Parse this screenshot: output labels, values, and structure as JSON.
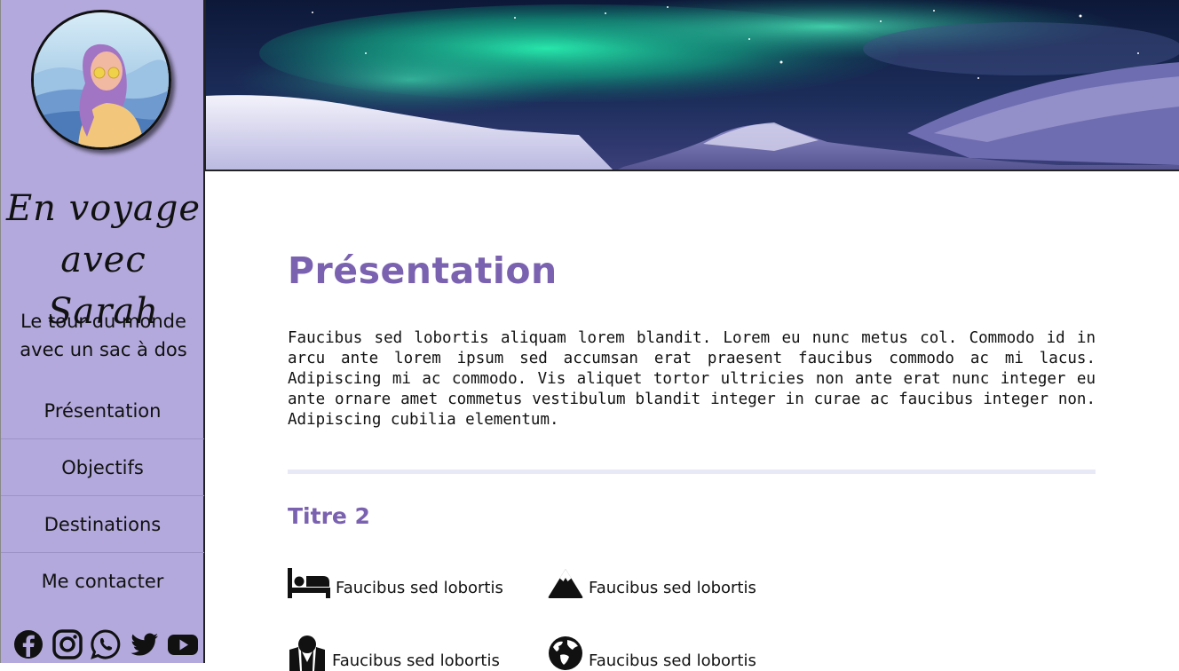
{
  "sidebar": {
    "brand_line1": "En voyage",
    "brand_line2": "avec Sarah",
    "tagline_line1": "Le tour du monde",
    "tagline_line2": "avec un sac à dos",
    "nav": [
      {
        "label": "Présentation"
      },
      {
        "label": "Objectifs"
      },
      {
        "label": "Destinations"
      },
      {
        "label": "Me contacter"
      }
    ],
    "social": [
      "facebook-icon",
      "instagram-icon",
      "whatsapp-icon",
      "twitter-icon",
      "youtube-icon"
    ]
  },
  "main": {
    "title": "Présentation",
    "paragraph": "Faucibus sed lobortis aliquam lorem blandit. Lorem eu nunc metus col. Commodo id in arcu ante lorem ipsum sed accumsan erat praesent faucibus commodo ac mi lacus. Adipiscing mi ac commodo. Vis aliquet tortor ultricies non ante erat nunc integer eu ante ornare amet commetus vestibulum blandit integer in curae ac faucibus integer non. Adipiscing cubilia elementum.",
    "subtitle": "Titre 2",
    "features": [
      {
        "icon": "bed-icon",
        "label": "Faucibus sed lobortis"
      },
      {
        "icon": "mountain-icon",
        "label": "Faucibus sed lobortis"
      },
      {
        "icon": "map-icon",
        "label": "Faucibus sed lobortis"
      },
      {
        "icon": "globe-icon",
        "label": "Faucibus sed lobortis"
      }
    ]
  },
  "colors": {
    "sidebar_bg": "#b4a9dc",
    "accent": "#7b62b0",
    "divider": "#e7e9f7"
  }
}
